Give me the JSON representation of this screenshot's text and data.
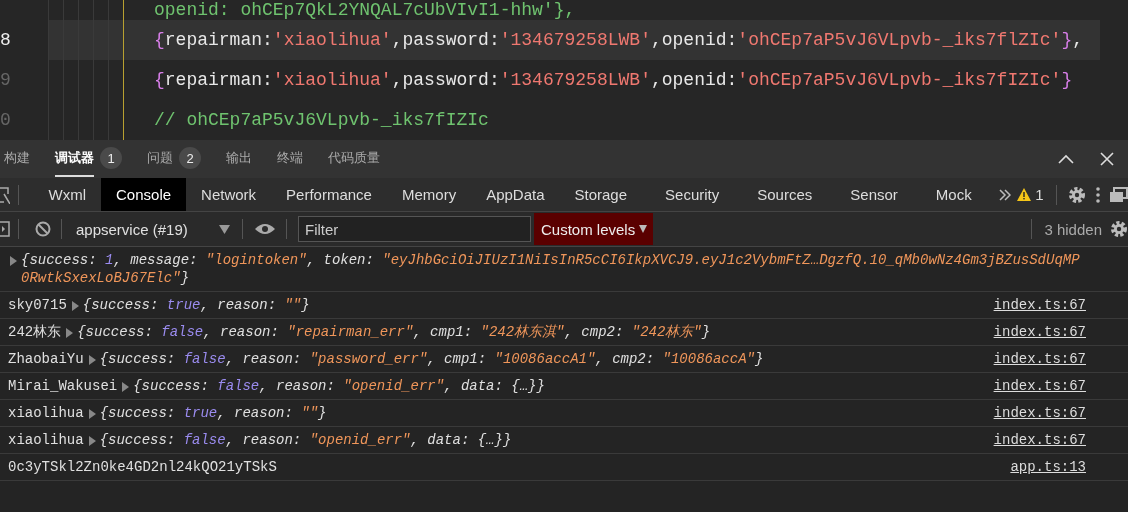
{
  "editor": {
    "lines": [
      {
        "current": false,
        "tokens": [
          {
            "kind": "comment",
            "text": "openid: ohCEp7QkL2YNQAL7cUbVIvI1-hhw'},"
          }
        ]
      },
      {
        "number": "8",
        "current": true,
        "tokens": [
          {
            "kind": "brace",
            "text": "{"
          },
          {
            "kind": "key",
            "text": "repairman:"
          },
          {
            "kind": "str",
            "text": "'xiaolihua'"
          },
          {
            "kind": "key",
            "text": ",password:"
          },
          {
            "kind": "str",
            "text": "'134679258LWB'"
          },
          {
            "kind": "key",
            "text": ",openid:"
          },
          {
            "kind": "str",
            "text": "'ohCEp7aP5vJ6VLpvb-_iks7flZIc'"
          },
          {
            "kind": "brace",
            "text": "}"
          },
          {
            "kind": "key",
            "text": ","
          }
        ]
      },
      {
        "number": "9",
        "current": false,
        "tokens": [
          {
            "kind": "brace",
            "text": "{"
          },
          {
            "kind": "key",
            "text": "repairman:"
          },
          {
            "kind": "str",
            "text": "'xiaolihua'"
          },
          {
            "kind": "key",
            "text": ",password:"
          },
          {
            "kind": "str",
            "text": "'134679258LWB'"
          },
          {
            "kind": "key",
            "text": ",openid:"
          },
          {
            "kind": "str",
            "text": "'ohCEp7aP5vJ6VLpvb-_iks7fIZIc'"
          },
          {
            "kind": "brace",
            "text": "}"
          }
        ]
      },
      {
        "number": "0",
        "current": false,
        "tokens": [
          {
            "kind": "comment",
            "text": "// ohCEp7aP5vJ6VLpvb-_iks7fIZIc"
          }
        ]
      }
    ]
  },
  "panel_tabs": [
    {
      "label": "构建",
      "selected": false
    },
    {
      "label": "调试器",
      "selected": true,
      "badge": "1"
    },
    {
      "label": "问题",
      "selected": false,
      "badge": "2"
    },
    {
      "label": "输出",
      "selected": false
    },
    {
      "label": "终端",
      "selected": false
    },
    {
      "label": "代码质量",
      "selected": false
    }
  ],
  "devtools_tabs": [
    {
      "label": "Wxml",
      "selected": false
    },
    {
      "label": "Console",
      "selected": true
    },
    {
      "label": "Network",
      "selected": false
    },
    {
      "label": "Performance",
      "selected": false
    },
    {
      "label": "Memory",
      "selected": false
    },
    {
      "label": "AppData",
      "selected": false
    },
    {
      "label": "Storage",
      "selected": false
    },
    {
      "label": "Security",
      "selected": false
    },
    {
      "label": "Sources",
      "selected": false
    },
    {
      "label": "Sensor",
      "selected": false
    },
    {
      "label": "Mock",
      "selected": false
    }
  ],
  "warning_count": "1",
  "toolbar": {
    "context": "appservice (#19)",
    "filter_placeholder": "Filter",
    "levels": "Custom levels",
    "hidden": "3 hidden"
  },
  "console": [
    {
      "expandable": true,
      "tokens": [
        {
          "kind": "t",
          "text": "{success: "
        },
        {
          "kind": "v",
          "text": "1"
        },
        {
          "kind": "t",
          "text": ", message: "
        },
        {
          "kind": "s",
          "text": "\"logintoken\""
        },
        {
          "kind": "t",
          "text": ", token: "
        },
        {
          "kind": "s",
          "text": "\"eyJhbGciOiJIUzI1NiIsInR5cCI6IkpXVCJ9.eyJ1c2VybmFtZ…DgzfQ.10_qMb0wNz4Gm3jBZusSdUqMP0RwtkSxexLoBJ67Elc\""
        },
        {
          "kind": "t",
          "text": "}"
        }
      ]
    },
    {
      "prefix": "sky0715",
      "expandable": true,
      "source": "index.ts:67",
      "tokens": [
        {
          "kind": "t",
          "text": "{success: "
        },
        {
          "kind": "v",
          "text": "true"
        },
        {
          "kind": "t",
          "text": ", reason: "
        },
        {
          "kind": "s",
          "text": "\"\""
        },
        {
          "kind": "t",
          "text": "}"
        }
      ]
    },
    {
      "prefix": "242林东",
      "expandable": true,
      "source": "index.ts:67",
      "tokens": [
        {
          "kind": "t",
          "text": "{success: "
        },
        {
          "kind": "v",
          "text": "false"
        },
        {
          "kind": "t",
          "text": ", reason: "
        },
        {
          "kind": "s",
          "text": "\"repairman_err\""
        },
        {
          "kind": "t",
          "text": ", cmp1: "
        },
        {
          "kind": "s",
          "text": "\"242林东淇\""
        },
        {
          "kind": "t",
          "text": ", cmp2: "
        },
        {
          "kind": "s",
          "text": "\"242林东\""
        },
        {
          "kind": "t",
          "text": "}"
        }
      ]
    },
    {
      "prefix": "ZhaobaiYu",
      "expandable": true,
      "source": "index.ts:67",
      "tokens": [
        {
          "kind": "t",
          "text": "{success: "
        },
        {
          "kind": "v",
          "text": "false"
        },
        {
          "kind": "t",
          "text": ", reason: "
        },
        {
          "kind": "s",
          "text": "\"password_err\""
        },
        {
          "kind": "t",
          "text": ", cmp1: "
        },
        {
          "kind": "s",
          "text": "\"10086accA1\""
        },
        {
          "kind": "t",
          "text": ", cmp2: "
        },
        {
          "kind": "s",
          "text": "\"10086accA\""
        },
        {
          "kind": "t",
          "text": "}"
        }
      ]
    },
    {
      "prefix": "Mirai_Wakusei",
      "expandable": true,
      "source": "index.ts:67",
      "tokens": [
        {
          "kind": "t",
          "text": "{success: "
        },
        {
          "kind": "v",
          "text": "false"
        },
        {
          "kind": "t",
          "text": ", reason: "
        },
        {
          "kind": "s",
          "text": "\"openid_err\""
        },
        {
          "kind": "t",
          "text": ", data: {…}}"
        }
      ]
    },
    {
      "prefix": "xiaolihua",
      "expandable": true,
      "source": "index.ts:67",
      "tokens": [
        {
          "kind": "t",
          "text": "{success: "
        },
        {
          "kind": "v",
          "text": "true"
        },
        {
          "kind": "t",
          "text": ", reason: "
        },
        {
          "kind": "s",
          "text": "\"\""
        },
        {
          "kind": "t",
          "text": "}"
        }
      ]
    },
    {
      "prefix": "xiaolihua",
      "expandable": true,
      "source": "index.ts:67",
      "tokens": [
        {
          "kind": "t",
          "text": "{success: "
        },
        {
          "kind": "v",
          "text": "false"
        },
        {
          "kind": "t",
          "text": ", reason: "
        },
        {
          "kind": "s",
          "text": "\"openid_err\""
        },
        {
          "kind": "t",
          "text": ", data: {…}}"
        }
      ]
    },
    {
      "prefix": "0c3yTSkl2Zn0ke4GD2nl24kQO21yTSkS",
      "expandable": false,
      "source": "app.ts:13"
    }
  ]
}
